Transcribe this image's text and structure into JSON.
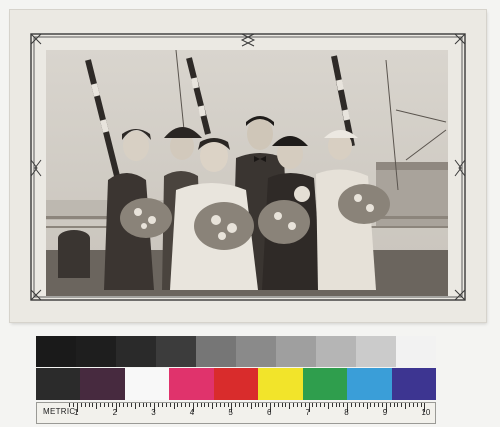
{
  "photograph": {
    "subject": "group-portrait-on-ship-deck",
    "people": [
      "woman-in-cloche-hat-left",
      "woman-in-brimmed-hat",
      "woman-in-white-coat-center",
      "man-in-bow-tie",
      "woman-in-dark-hat",
      "woman-in-white-cap-right"
    ],
    "tone": "sepia-monochrome"
  },
  "color_target": {
    "gray_patches": [
      "#1a1a1a",
      "#1e1e1e",
      "#2a2a2a",
      "#3c3c3c",
      "#767676",
      "#8a8a8a",
      "#9f9f9f",
      "#b5b5b5",
      "#cbcbcb",
      "#f2f2f2"
    ],
    "color_patches": [
      "#2b2b2b",
      "#472a3f",
      "#f8f8f8",
      "#e0336c",
      "#d92c2c",
      "#f2e42a",
      "#2f9e4d",
      "#3a9ed8",
      "#3d3591"
    ],
    "ruler_label": "METRIC",
    "ruler_numbers": [
      "1",
      "2",
      "3",
      "4",
      "5",
      "6",
      "7",
      "8",
      "9",
      "10"
    ]
  }
}
